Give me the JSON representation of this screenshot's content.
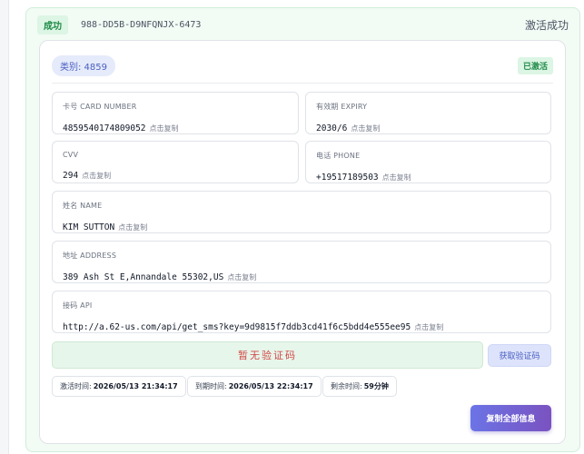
{
  "header": {
    "badge": "成功",
    "code": "988-DD5B-D9NFQNJX-6473",
    "status": "激活成功"
  },
  "card": {
    "category": "类别: 4859",
    "activated": "已激活",
    "fields": {
      "card_number": {
        "label": "卡号 CARD NUMBER",
        "value": "4859540174809052",
        "copy": "点击复制"
      },
      "expiry": {
        "label": "有效期 EXPIRY",
        "value": "2030/6",
        "copy": "点击复制"
      },
      "cvv": {
        "label": "CVV",
        "value": "294",
        "copy": "点击复制"
      },
      "phone": {
        "label": "电话 PHONE",
        "value": "+19517189503",
        "copy": "点击复制"
      },
      "name": {
        "label": "姓名 NAME",
        "value": "KIM SUTTON",
        "copy": "点击复制"
      },
      "address": {
        "label": "地址 ADDRESS",
        "value": "389 Ash St E,Annandale 55302,US",
        "copy": "点击复制"
      },
      "api": {
        "label": "接码 API",
        "value": "http://a.62-us.com/api/get_sms?key=9d9815f7ddb3cd41f6c5bdd4e555ee95",
        "copy": "点击复制"
      }
    },
    "sms_placeholder": "暂无验证码",
    "get_code_label": "获取验证码",
    "times": {
      "activated": {
        "label": "激活时间:",
        "value": "2026/05/13 21:34:17"
      },
      "expires": {
        "label": "到期时间:",
        "value": "2026/05/13 22:34:17"
      },
      "remaining": {
        "label": "剩余时间:",
        "value": "59分钟"
      }
    },
    "copy_all_label": "复制全部信息"
  }
}
